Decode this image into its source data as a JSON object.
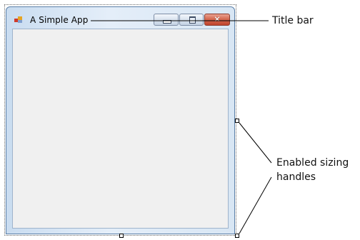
{
  "window": {
    "title": "A Simple App",
    "app_icon": "windows-app-icon",
    "buttons": {
      "minimize": {
        "icon": "minimize-icon"
      },
      "maximize": {
        "icon": "maximize-icon"
      },
      "close": {
        "icon": "close-icon",
        "glyph": "✕"
      }
    }
  },
  "annotations": {
    "title_bar": "Title bar",
    "sizing_handles_line1": "Enabled sizing",
    "sizing_handles_line2": "handles"
  },
  "colors": {
    "close_button": "#d56a52",
    "window_frame": "#c9dcf0",
    "client_area": "#f0f0f0"
  }
}
